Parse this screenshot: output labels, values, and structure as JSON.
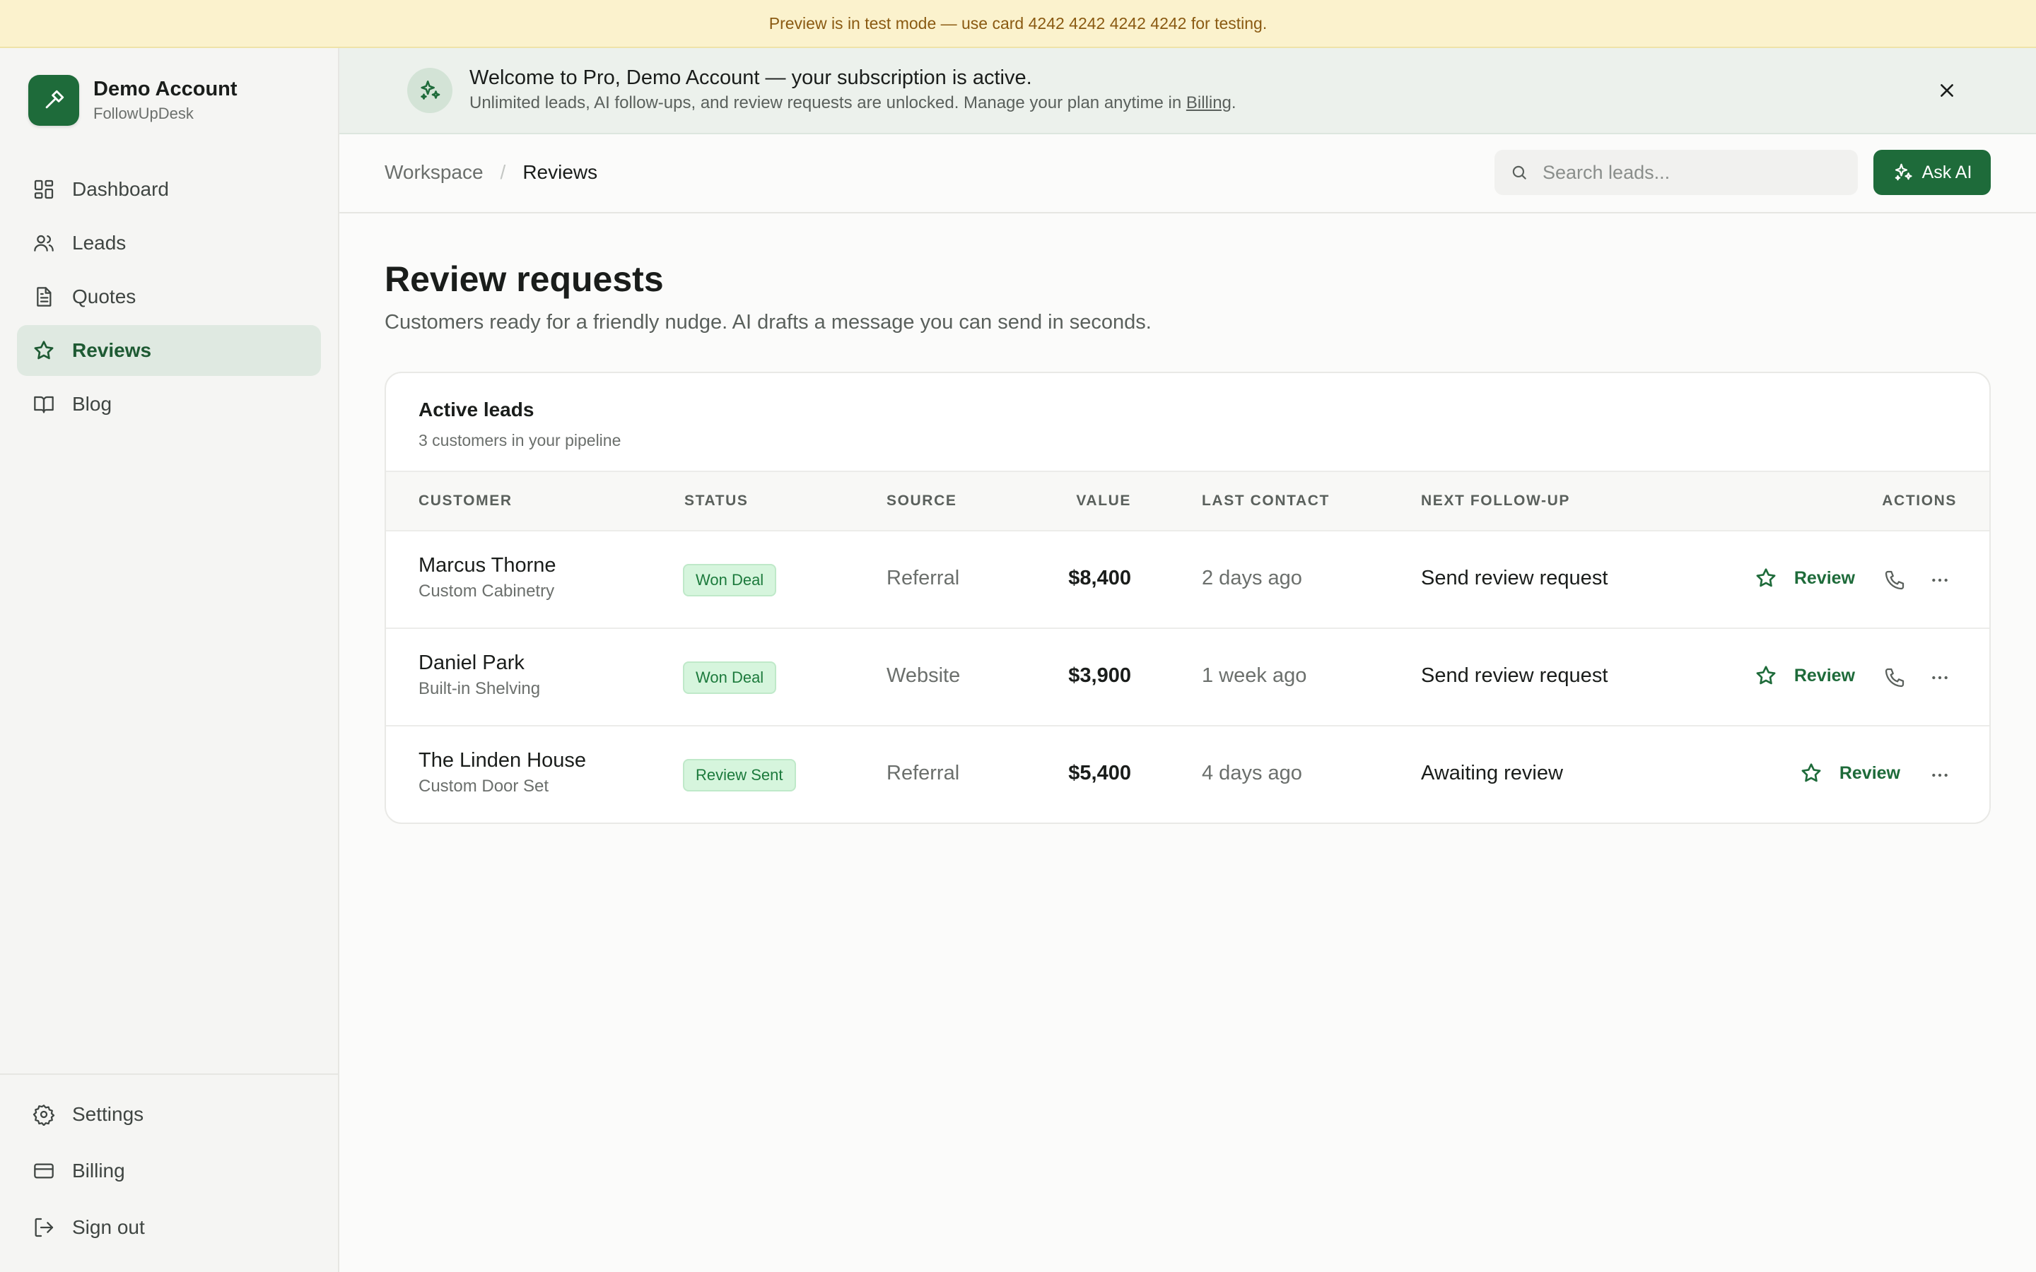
{
  "test_banner": {
    "text": "Preview is in test mode — use card 4242  4242  4242  4242 for testing."
  },
  "account": {
    "name": "Demo Account",
    "product": "FollowUpDesk"
  },
  "nav": {
    "items": [
      {
        "label": "Dashboard",
        "icon": "dashboard-icon"
      },
      {
        "label": "Leads",
        "icon": "users-icon"
      },
      {
        "label": "Quotes",
        "icon": "document-icon"
      },
      {
        "label": "Reviews",
        "icon": "star-icon",
        "active": true
      },
      {
        "label": "Blog",
        "icon": "book-icon"
      }
    ],
    "bottom": [
      {
        "label": "Settings",
        "icon": "gear-icon"
      },
      {
        "label": "Billing",
        "icon": "credit-card-icon"
      },
      {
        "label": "Sign out",
        "icon": "sign-out-icon"
      }
    ]
  },
  "welcome": {
    "title": "Welcome to Pro, Demo Account — your subscription is active.",
    "subtitle": "Unlimited leads, AI follow-ups, and review requests are unlocked. Manage your plan anytime in ",
    "link": "Billing",
    "suffix": "."
  },
  "breadcrumb": {
    "root": "Workspace",
    "separator": "/",
    "current": "Reviews"
  },
  "search": {
    "placeholder": "Search leads..."
  },
  "ask_ai": {
    "label": "Ask AI"
  },
  "page": {
    "title": "Review requests",
    "subtitle": "Customers ready for a friendly nudge. AI drafts a message you can send in seconds."
  },
  "card": {
    "title": "Active leads",
    "subtitle": "3 customers in your pipeline"
  },
  "table": {
    "columns": {
      "customer": "CUSTOMER",
      "status": "STATUS",
      "source": "SOURCE",
      "value": "VALUE",
      "last_contact": "LAST CONTACT",
      "next_followup": "NEXT FOLLOW-UP",
      "actions": "ACTIONS"
    },
    "rows": [
      {
        "name": "Marcus Thorne",
        "project": "Custom Cabinetry",
        "status": "Won Deal",
        "source": "Referral",
        "value": "$8,400",
        "last_contact": "2 days ago",
        "next": "Send review request",
        "action": "Review",
        "has_phone": true
      },
      {
        "name": "Daniel Park",
        "project": "Built-in Shelving",
        "status": "Won Deal",
        "source": "Website",
        "value": "$3,900",
        "last_contact": "1 week ago",
        "next": "Send review request",
        "action": "Review",
        "has_phone": true
      },
      {
        "name": "The Linden House",
        "project": "Custom Door Set",
        "status": "Review Sent",
        "source": "Referral",
        "value": "$5,400",
        "last_contact": "4 days ago",
        "next": "Awaiting review",
        "action": "Review",
        "has_phone": false
      }
    ]
  },
  "colors": {
    "brand": "#1e6b3a",
    "banner_bg": "#fbf2cd",
    "banner_text": "#8a5a12",
    "welcome_bg": "#ecf1ec",
    "active_nav_bg": "#dfe9e1",
    "badge_bg": "#d6f5dd",
    "badge_text": "#1c7a3c"
  }
}
